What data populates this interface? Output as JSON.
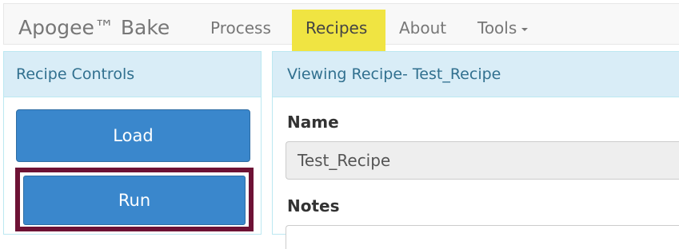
{
  "navbar": {
    "brand": "Apogee™ Bake",
    "items": [
      {
        "label": "Process"
      },
      {
        "label": "Recipes",
        "active": true
      },
      {
        "label": "About"
      },
      {
        "label": "Tools"
      }
    ]
  },
  "left_panel": {
    "title": "Recipe Controls",
    "load_label": "Load",
    "run_label": "Run"
  },
  "right_panel": {
    "title": "Viewing Recipe- Test_Recipe",
    "name_label": "Name",
    "name_value": "Test_Recipe",
    "notes_label": "Notes",
    "notes_value": ""
  },
  "colors": {
    "active_tab_highlight": "#f0e442",
    "panel_heading_bg": "#d9edf7",
    "panel_heading_text": "#31708f",
    "primary_button": "#3a87cc",
    "run_highlight_outline": "#6d1235"
  }
}
